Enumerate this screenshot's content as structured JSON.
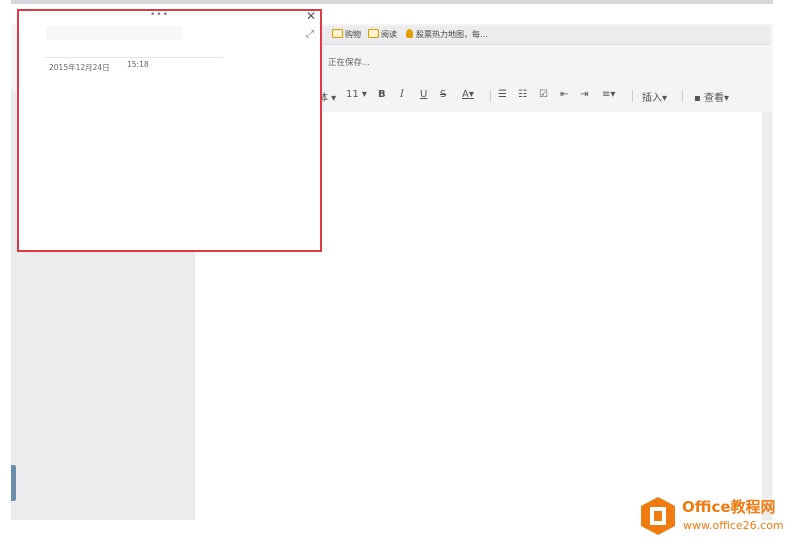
{
  "bookmarks": [
    {
      "label": "购物"
    },
    {
      "label": "阅读"
    },
    {
      "label": "股票热力地图，每..."
    }
  ],
  "status": {
    "saving_text": "正在保存..."
  },
  "toolbar": {
    "font_family_tail": "体",
    "font_size": "11",
    "bold": "B",
    "italic": "I",
    "underline": "U",
    "strike": "S",
    "font_color": "A",
    "insert": "插入",
    "view": "查看"
  },
  "note": {
    "date": "2015年12月24日",
    "time": "15:18"
  },
  "watermark": {
    "brand": "Office教程网",
    "url": "www.office26.com",
    "brand_color": "#f07b10"
  },
  "colors": {
    "highlight_border": "#e03a44"
  }
}
